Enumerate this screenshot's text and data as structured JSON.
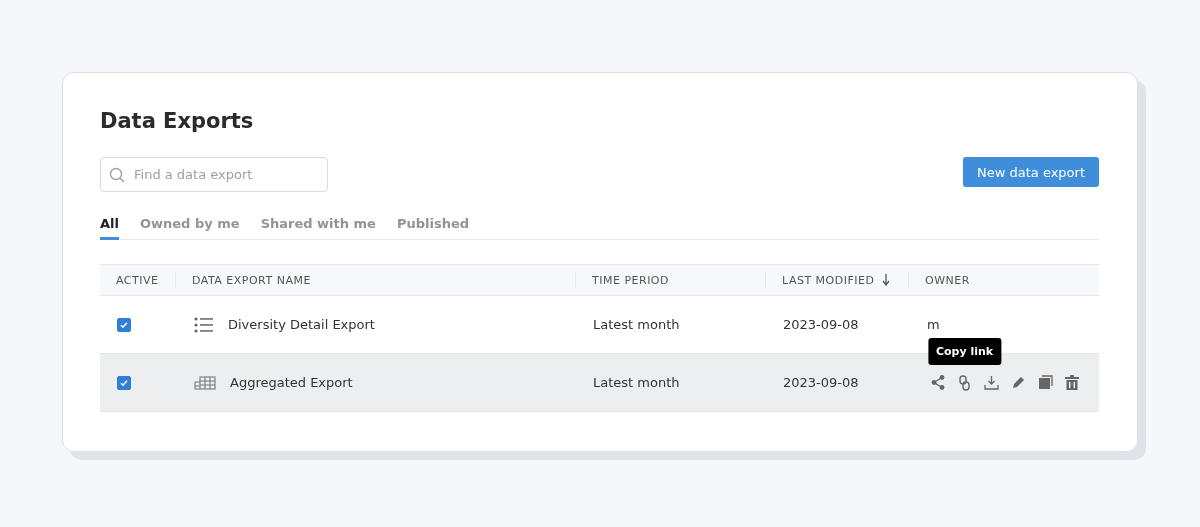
{
  "title": "Data Exports",
  "search": {
    "placeholder": "Find a data export"
  },
  "new_button": "New data export",
  "tabs": [
    {
      "label": "All",
      "selected": true
    },
    {
      "label": "Owned by me",
      "selected": false
    },
    {
      "label": "Shared with me",
      "selected": false
    },
    {
      "label": "Published",
      "selected": false
    }
  ],
  "columns": [
    {
      "label": "ACTIVE",
      "sorted": false
    },
    {
      "label": "DATA EXPORT NAME",
      "sorted": false
    },
    {
      "label": "TIME PERIOD",
      "sorted": false
    },
    {
      "label": "LAST MODIFIED",
      "sorted": true
    },
    {
      "label": "OWNER",
      "sorted": false
    }
  ],
  "rows": [
    {
      "active": true,
      "kind": "list",
      "name": "Diversity Detail Export",
      "time_period": "Latest month",
      "last_modified": "2023-09-08",
      "owner": "m",
      "hovered": false
    },
    {
      "active": true,
      "kind": "table",
      "name": "Aggregated Export",
      "time_period": "Latest month",
      "last_modified": "2023-09-08",
      "owner": "",
      "hovered": true
    }
  ],
  "tooltip": "Copy link"
}
